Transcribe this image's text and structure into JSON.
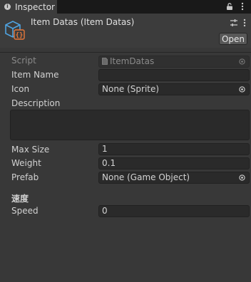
{
  "tab": {
    "label": "Inspector",
    "info_icon": "info-icon",
    "lock_icon": "lock-icon",
    "menu_icon": "kebab-menu-icon"
  },
  "header": {
    "title": "Item Datas (Item Datas)",
    "open_label": "Open",
    "icon": "script-icon"
  },
  "fields": {
    "script": {
      "label": "Script",
      "value": "ItemDatas"
    },
    "item_name": {
      "label": "Item Name",
      "value": ""
    },
    "icon": {
      "label": "Icon",
      "value": "None (Sprite)"
    },
    "description": {
      "label": "Description",
      "value": ""
    },
    "max_size": {
      "label": "Max Size",
      "value": "1"
    },
    "weight": {
      "label": "Weight",
      "value": "0.1"
    },
    "prefab": {
      "label": "Prefab",
      "value": "None (Game Object)"
    },
    "speed_header": "速度",
    "speed": {
      "label": "Speed",
      "value": "0"
    }
  },
  "colors": {
    "background": "#383838",
    "tabbar": "#191919",
    "field_bg": "#2a2a2a",
    "script_icon_blue": "#4fa3e0",
    "script_icon_orange": "#e8783a"
  }
}
